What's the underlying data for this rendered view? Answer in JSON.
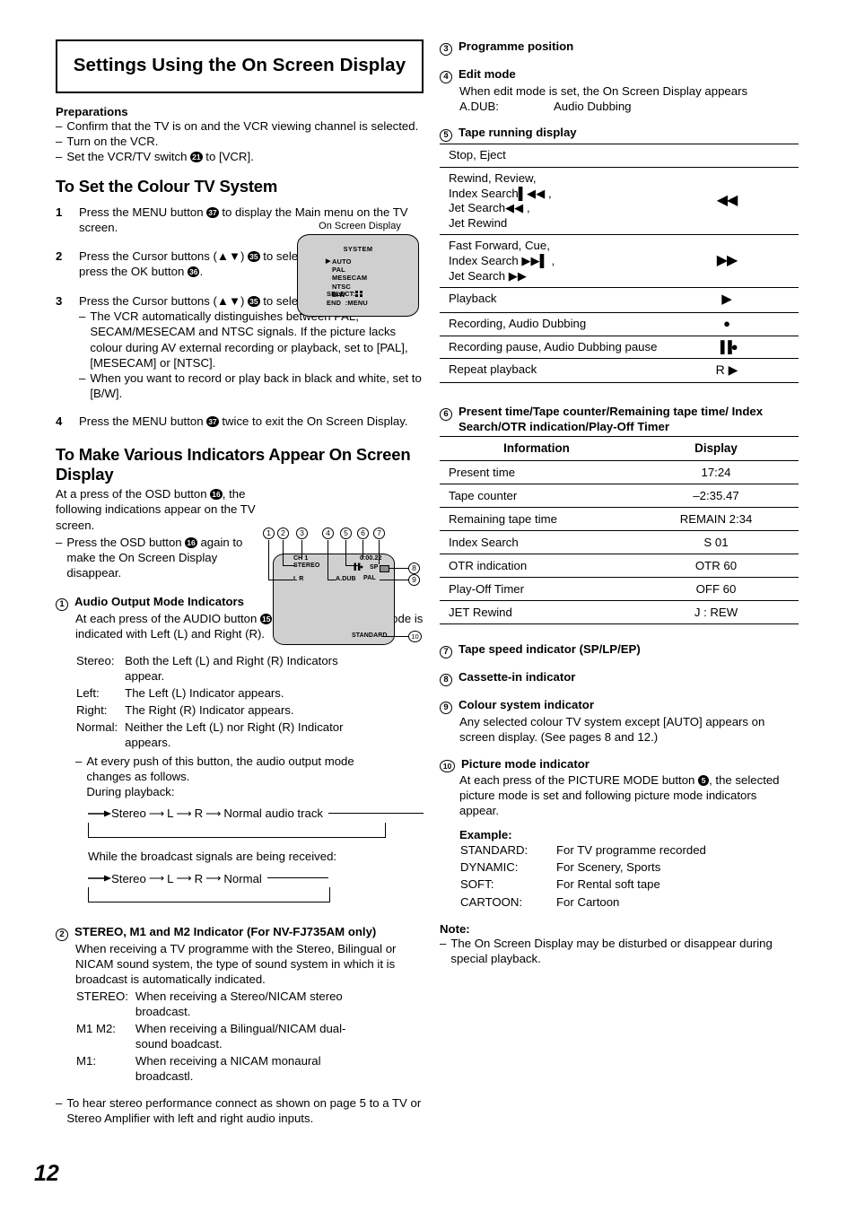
{
  "page": {
    "number": "12"
  },
  "title": "Settings Using the On Screen Display",
  "preparations": {
    "heading": "Preparations",
    "items": [
      "Confirm that the TV is on and the VCR viewing channel is selected.",
      "Turn on the VCR.",
      "Set the VCR/TV switch ㉑ to [VCR]."
    ],
    "item3_pre": "Set the VCR/TV switch",
    "item3_ref": "21",
    "item3_post": "to [VCR]."
  },
  "colour_tv_system": {
    "heading": "To Set the Colour TV System",
    "steps": [
      {
        "num": "1",
        "pre": "Press the MENU button",
        "ref": "37",
        "post": "to display the Main menu on the TV screen."
      },
      {
        "num": "2",
        "pre": "Press the Cursor buttons (▲▼)",
        "ref": "35",
        "mid": "to select [SYSTEM] then press the OK button",
        "ref2": "36",
        "post": "."
      },
      {
        "num": "3",
        "pre": "Press the Cursor buttons (▲▼)",
        "ref": "35",
        "post": "to select [AUTO]."
      },
      {
        "num": "4",
        "pre": "Press the MENU button",
        "ref": "37",
        "post": "twice to exit the On Screen Display."
      }
    ],
    "step3_notes": [
      "The VCR automatically distinguishes between PAL, SECAM/MESECAM and NTSC signals. If the picture lacks colour during AV external recording or playback, set to [PAL], [MESECAM] or [NTSC].",
      "When you want to record or play back in black and white, set to [B/W]."
    ]
  },
  "osd_menu": {
    "caption": "On Screen Display",
    "title": "SYSTEM",
    "options": [
      "AUTO",
      "PAL",
      "MESECAM",
      "NTSC",
      "B/W"
    ],
    "selected": "AUTO",
    "select_label": "SELECT:",
    "end_label": "END",
    "end_value": ":MENU"
  },
  "indicators_section": {
    "heading": "To Make Various Indicators Appear On Screen Display",
    "intro_pre": "At a press of the OSD button",
    "intro_ref": "16",
    "intro_post": ", the following indications appear on the TV screen.",
    "note_pre": "Press the OSD button",
    "note_ref": "16",
    "note_post": "again to make the On Screen Display disappear."
  },
  "tv_diagram": {
    "callouts": [
      "1",
      "2",
      "3",
      "4",
      "5",
      "6",
      "7",
      "8",
      "9",
      "10"
    ],
    "labels": {
      "channel": "CH 1",
      "stereo": "STEREO",
      "lr": "L R",
      "adub": "A.DUB",
      "counter": "0:00.22",
      "speed": "SP",
      "system": "PAL",
      "picture_mode": "STANDARD",
      "pause_rec": "▐▐●"
    }
  },
  "item1": {
    "callout": "1",
    "heading": "Audio Output Mode Indicators",
    "intro_pre": "At each press of the AUDIO button",
    "intro_ref": "15",
    "intro_post": ", the selected sound mode is indicated with Left (L) and Right (R).",
    "modes": [
      {
        "name": "Stereo:",
        "desc": "Both the Left (L) and Right (R) Indicators appear."
      },
      {
        "name": "Left:",
        "desc": "The Left (L) Indicator appears."
      },
      {
        "name": "Right:",
        "desc": "The Right (R) Indicator appears."
      },
      {
        "name": "Normal:",
        "desc": "Neither the Left (L) nor Right (R) Indicator appears."
      }
    ],
    "change_note": "At every push of this button, the audio output mode changes as follows.",
    "playback_label": "During playback:",
    "playback_flow": "Stereo → L → R → Normal audio track",
    "playback_items": [
      "Stereo",
      "L",
      "R",
      "Normal audio track"
    ],
    "broadcast_label": "While the broadcast signals are being received:",
    "broadcast_items": [
      "Stereo",
      "L",
      "R",
      "Normal"
    ]
  },
  "item2": {
    "callout": "2",
    "heading": "STEREO, M1 and M2 Indicator (For NV-FJ735AM only)",
    "intro": "When receiving a TV programme with the Stereo, Bilingual or NICAM sound system, the type of sound system in which it is broadcast is automatically indicated.",
    "rows": [
      {
        "name": "STEREO:",
        "desc": "When receiving a Stereo/NICAM stereo broadcast."
      },
      {
        "name": "M1 M2:",
        "desc": "When receiving a Bilingual/NICAM dual-sound boadcast."
      },
      {
        "name": "M1:",
        "desc": "When receiving a NICAM monaural broadcastl."
      }
    ],
    "note": "To hear stereo performance connect as shown on page 5 to a TV or Stereo Amplifier with left and right audio inputs."
  },
  "item3": {
    "callout": "3",
    "heading": "Programme position"
  },
  "item4": {
    "callout": "4",
    "heading": "Edit mode",
    "intro": "When edit mode is set, the On Screen Display appears",
    "term": "A.DUB:",
    "definition": "Audio Dubbing"
  },
  "item5": {
    "callout": "5",
    "heading": "Tape running display",
    "rows": [
      {
        "label": "Stop, Eject",
        "symbol": ""
      },
      {
        "label": "Rewind, Review,\nIndex Search ▎◀◀ ,\nJet Search ◀◀ ,\nJet Rewind",
        "symbol": "◀◀"
      },
      {
        "label": "Fast Forward, Cue,\nIndex Search ▶▶▎ ,\nJet Search ▶▶",
        "symbol": "▶▶"
      },
      {
        "label": "Playback",
        "symbol": "▶"
      },
      {
        "label": "Recording, Audio Dubbing",
        "symbol": "●"
      },
      {
        "label": "Recording pause, Audio Dubbing pause",
        "symbol": "▐▐●"
      },
      {
        "label": "Repeat playback",
        "symbol": "R ▶"
      }
    ]
  },
  "item6": {
    "callout": "6",
    "heading": "Present time/Tape counter/Remaining tape time/ Index Search/OTR indication/Play-Off Timer",
    "columns": [
      "Information",
      "Display"
    ],
    "rows": [
      [
        "Present time",
        "17:24"
      ],
      [
        "Tape counter",
        "–2:35.47"
      ],
      [
        "Remaining tape time",
        "REMAIN 2:34"
      ],
      [
        "Index Search",
        "S 01"
      ],
      [
        "OTR indication",
        "OTR 60"
      ],
      [
        "Play-Off Timer",
        "OFF 60"
      ],
      [
        "JET Rewind",
        "J : REW"
      ]
    ]
  },
  "item7": {
    "callout": "7",
    "heading": "Tape speed indicator (SP/LP/EP)"
  },
  "item8": {
    "callout": "8",
    "heading": "Cassette-in indicator"
  },
  "item9": {
    "callout": "9",
    "heading": "Colour system indicator",
    "body": "Any selected colour TV system except [AUTO] appears on screen display. (See pages 8 and 12.)"
  },
  "item10": {
    "callout": "10",
    "heading": "Picture mode indicator",
    "body_pre": "At each press of the PICTURE MODE button",
    "body_ref": "5",
    "body_post": ", the selected picture mode is set and following picture mode indicators appear.",
    "example_label": "Example:",
    "examples": [
      {
        "name": "STANDARD:",
        "desc": "For TV programme recorded"
      },
      {
        "name": "DYNAMIC:",
        "desc": "For Scenery, Sports"
      },
      {
        "name": "SOFT:",
        "desc": "For Rental soft tape"
      },
      {
        "name": "CARTOON:",
        "desc": "For Cartoon"
      }
    ],
    "note_label": "Note:",
    "note": "The On Screen Display may be disturbed or disappear during special playback."
  }
}
